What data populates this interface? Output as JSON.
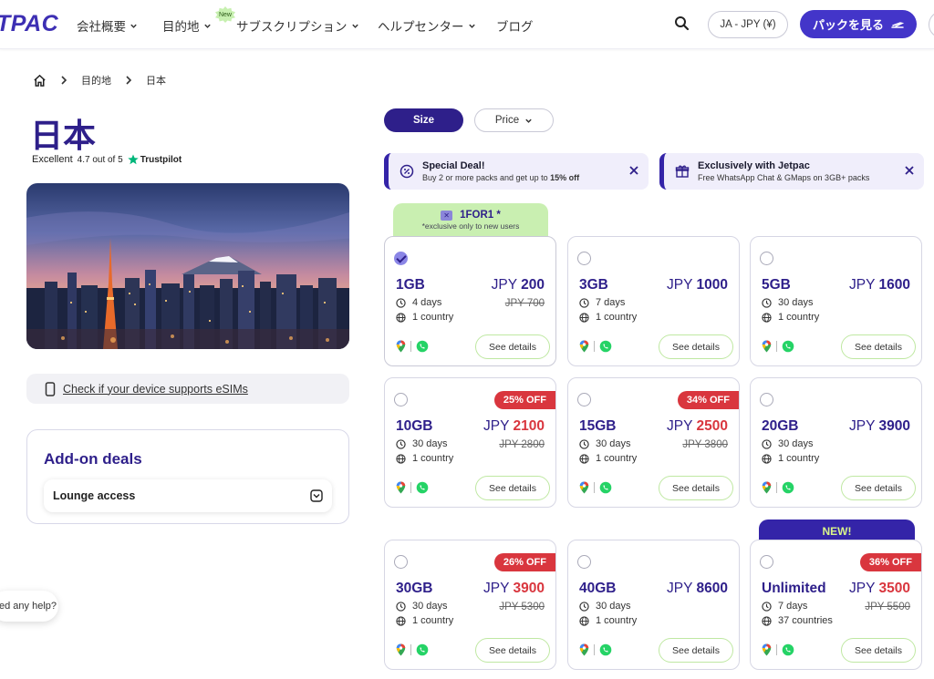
{
  "header": {
    "logo": "TPAC",
    "nav": [
      {
        "label": "会社概要"
      },
      {
        "label": "目的地"
      },
      {
        "label": "サブスクリプション"
      },
      {
        "label": "ヘルプセンター"
      },
      {
        "label": "ブログ"
      }
    ],
    "new_badge": "New",
    "lang_label": "JA - JPY (¥)",
    "cta_label": "パックを見る"
  },
  "breadcrumb": {
    "items": [
      "目的地",
      "日本"
    ]
  },
  "page": {
    "title": "日本",
    "rating_text": "Excellent",
    "rating_score": "4.7 out of 5",
    "trustpilot": "Trustpilot",
    "check_device": "Check if your device supports eSIMs",
    "addon_title": "Add-on deals",
    "lounge_label": "Lounge access",
    "help_text": "ed any help?"
  },
  "filters": {
    "size": "Size",
    "price": "Price"
  },
  "banners": [
    {
      "title": "Special Deal!",
      "subtitle_pre": "Buy 2 or more packs and get up to ",
      "subtitle_bold": "15% off"
    },
    {
      "title": "Exclusively with Jetpac",
      "subtitle": "Free WhatsApp Chat & GMaps on 3GB+ packs"
    }
  ],
  "promo": {
    "code": "1FOR1 *",
    "note": "*exclusive only to new users"
  },
  "new_tab": "NEW!",
  "see_details": "See details",
  "plans": [
    {
      "size": "1GB",
      "currency": "JPY",
      "price": "200",
      "old_price": "JPY 700",
      "days": "4 days",
      "countries": "1 country",
      "discount": "",
      "selected": true,
      "red": false
    },
    {
      "size": "3GB",
      "currency": "JPY",
      "price": "1000",
      "old_price": "",
      "days": "7 days",
      "countries": "1 country",
      "discount": "",
      "selected": false,
      "red": false
    },
    {
      "size": "5GB",
      "currency": "JPY",
      "price": "1600",
      "old_price": "",
      "days": "30 days",
      "countries": "1 country",
      "discount": "",
      "selected": false,
      "red": false
    },
    {
      "size": "10GB",
      "currency": "JPY",
      "price": "2100",
      "old_price": "JPY 2800",
      "days": "30 days",
      "countries": "1 country",
      "discount": "25% OFF",
      "selected": false,
      "red": true
    },
    {
      "size": "15GB",
      "currency": "JPY",
      "price": "2500",
      "old_price": "JPY 3800",
      "days": "30 days",
      "countries": "1 country",
      "discount": "34% OFF",
      "selected": false,
      "red": true
    },
    {
      "size": "20GB",
      "currency": "JPY",
      "price": "3900",
      "old_price": "",
      "days": "30 days",
      "countries": "1 country",
      "discount": "",
      "selected": false,
      "red": false
    },
    {
      "size": "30GB",
      "currency": "JPY",
      "price": "3900",
      "old_price": "JPY 5300",
      "days": "30 days",
      "countries": "1 country",
      "discount": "26% OFF",
      "selected": false,
      "red": true
    },
    {
      "size": "40GB",
      "currency": "JPY",
      "price": "8600",
      "old_price": "",
      "days": "30 days",
      "countries": "1 country",
      "discount": "",
      "selected": false,
      "red": false
    },
    {
      "size": "Unlimited",
      "currency": "JPY",
      "price": "3500",
      "old_price": "JPY 5500",
      "days": "7 days",
      "countries": "37 countries",
      "discount": "36% OFF",
      "selected": false,
      "red": true
    }
  ],
  "colors": {
    "brand": "#2e1f8a",
    "accent": "#4335c9",
    "green": "#c9efb1",
    "sale": "#d9363e"
  }
}
